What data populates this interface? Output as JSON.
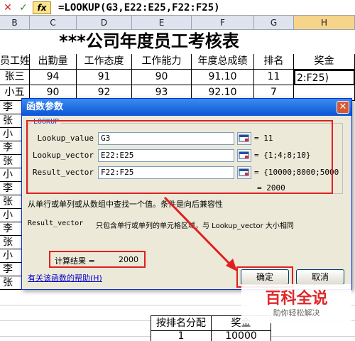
{
  "formula_bar": {
    "cancel_glyph": "✕",
    "confirm_glyph": "✓",
    "fx_label": "fx",
    "formula": "=LOOKUP(G3,E22:E25,F22:F25)"
  },
  "columns": [
    "B",
    "C",
    "D",
    "E",
    "F",
    "G",
    "H"
  ],
  "sheet": {
    "title": "***公司年度员工考核表",
    "headers": [
      "员工姓名",
      "出勤量",
      "工作态度",
      "工作能力",
      "年度总成绩",
      "排名",
      "奖金"
    ],
    "row1": [
      "张三",
      "94",
      "91",
      "90",
      "91.10",
      "11",
      "2:F25)"
    ],
    "row2": [
      "小五",
      "90",
      "92",
      "93",
      "92.10",
      "7",
      ""
    ],
    "left_names": [
      "李",
      "张",
      "小",
      "李",
      "张",
      "小",
      "李",
      "张",
      "小",
      "李",
      "张",
      "小",
      "李",
      "张"
    ],
    "bottom_table": {
      "headers": [
        "按排名分配",
        "奖金"
      ],
      "row": [
        "1",
        "10000"
      ]
    }
  },
  "dialog": {
    "title": "函数参数",
    "close_glyph": "✕",
    "group_name": "LOOKUP",
    "args": [
      {
        "label": "Lookup_value",
        "value": "G3",
        "result": "= 11"
      },
      {
        "label": "Lookup_vector",
        "value": "E22:E25",
        "result": "= {1;4;8;10}"
      },
      {
        "label": "Result_vector",
        "value": "F22:F25",
        "result": "= {10000;8000;5000"
      }
    ],
    "overall_result": "= 2000",
    "description": "从单行或单列或从数组中查找一个值。条件是向后兼容性",
    "param_name": "Result_vector",
    "param_desc": "只包含单行或单列的单元格区域，与 Lookup_vector 大小相同",
    "calc_label": "计算结果 =",
    "calc_value": "2000",
    "help_link": "有关该函数的帮助(H)",
    "ok_label": "确定",
    "cancel_label": "取消"
  },
  "watermark": {
    "main": "百科全说",
    "sub": "助你轻松解决"
  },
  "colors": {
    "highlight_red": "#e02020",
    "dialog_bg": "#ece9d8",
    "title_blue": "#0a54d8"
  }
}
